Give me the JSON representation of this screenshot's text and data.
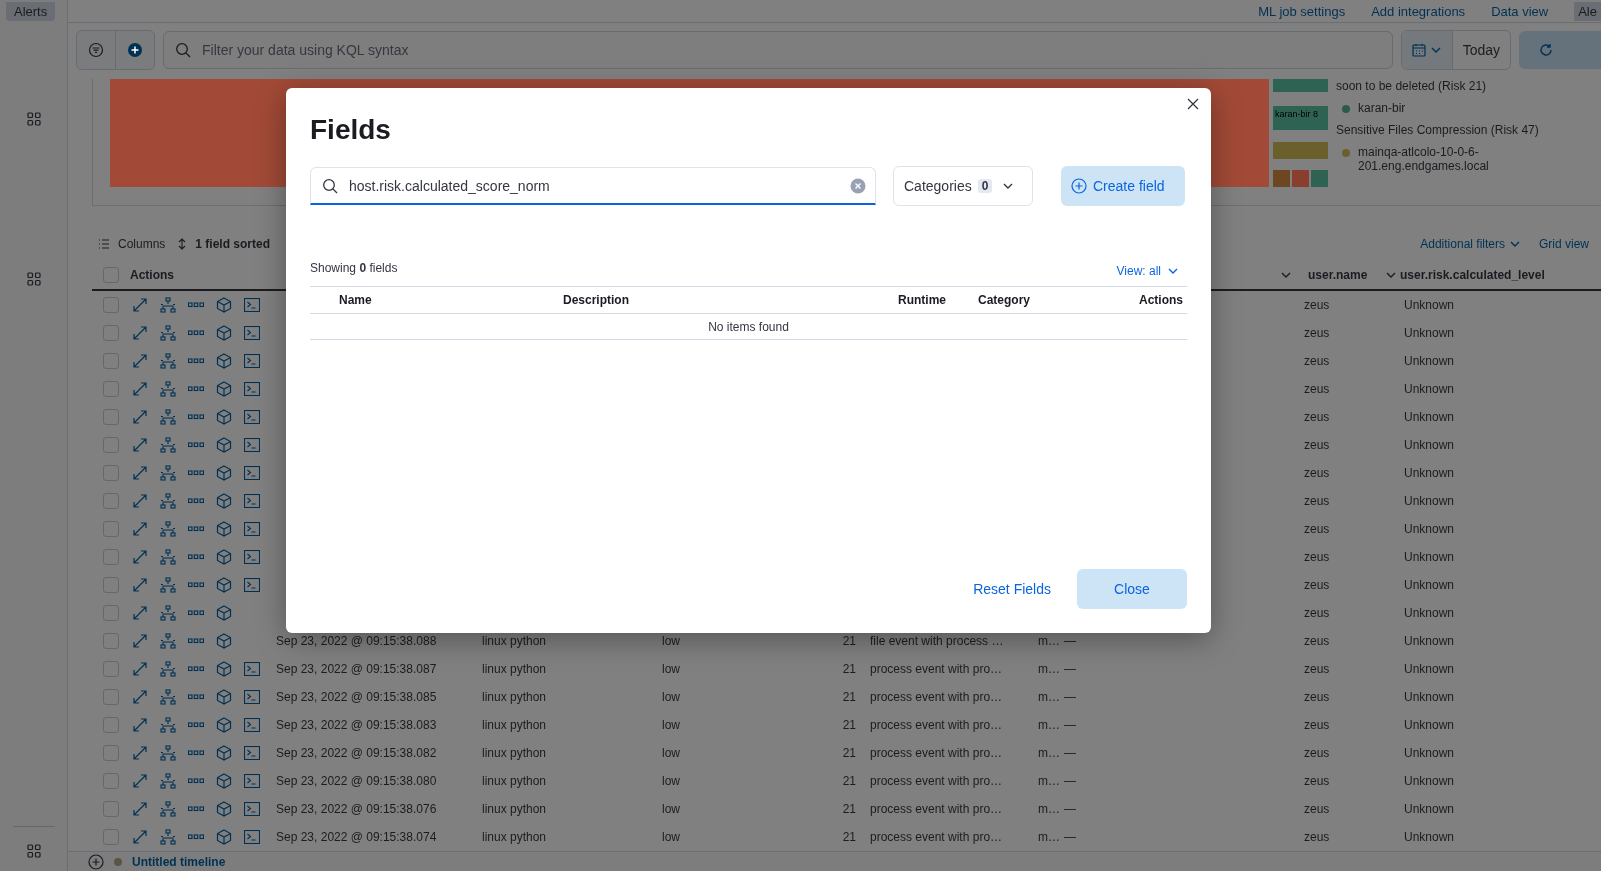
{
  "top_bar": {
    "tab": "Alerts",
    "links": [
      {
        "label": "ML job settings"
      },
      {
        "label": "Add integrations"
      },
      {
        "label": "Data view"
      }
    ],
    "corner_tab": "Ale"
  },
  "query_bar": {
    "placeholder": "Filter your data using KQL syntax",
    "date": "Today"
  },
  "treemap": {
    "block_label": "karan-bir 8",
    "legend": [
      {
        "kind": "group",
        "label": "soon to be deleted (Risk 21)"
      },
      {
        "kind": "host",
        "label": "karan-bir",
        "color": "#2a5a4c"
      },
      {
        "kind": "group",
        "label": "Sensitive Files Compression (Risk 47)"
      },
      {
        "kind": "host",
        "label": "mainqa-atlcolo-10-0-6-201.eng.endgames.local",
        "color": "#6b602c"
      }
    ]
  },
  "toolbar": {
    "columns": "Columns",
    "sorted": "1 field sorted",
    "additional_filters": "Additional filters",
    "grid_view": "Grid view"
  },
  "table": {
    "header_checked": false,
    "columns": [
      {
        "label": "Actions"
      },
      {
        "label": "user.name"
      },
      {
        "label": "user.risk.calculated_level"
      }
    ],
    "rows": [
      {
        "checked": false,
        "session_icon": true,
        "user": "zeus",
        "level": "Unknown"
      },
      {
        "checked": false,
        "session_icon": true,
        "user": "zeus",
        "level": "Unknown"
      },
      {
        "checked": false,
        "session_icon": true,
        "user": "zeus",
        "level": "Unknown"
      },
      {
        "checked": false,
        "session_icon": true,
        "user": "zeus",
        "level": "Unknown"
      },
      {
        "checked": false,
        "session_icon": true,
        "user": "zeus",
        "level": "Unknown"
      },
      {
        "checked": false,
        "session_icon": true,
        "user": "zeus",
        "level": "Unknown"
      },
      {
        "checked": false,
        "session_icon": true,
        "user": "zeus",
        "level": "Unknown"
      },
      {
        "checked": false,
        "session_icon": true,
        "user": "zeus",
        "level": "Unknown"
      },
      {
        "checked": false,
        "session_icon": true,
        "user": "zeus",
        "level": "Unknown"
      },
      {
        "checked": false,
        "session_icon": true,
        "user": "zeus",
        "level": "Unknown"
      },
      {
        "checked": false,
        "session_icon": true,
        "user": "zeus",
        "level": "Unknown"
      },
      {
        "checked": false,
        "session_icon": false,
        "user": "zeus",
        "level": "Unknown"
      },
      {
        "checked": false,
        "session_icon": false,
        "timestamp": "Sep 23, 2022 @ 09:15:38.088",
        "rule": "linux python",
        "severity": "low",
        "score": "21",
        "reason": "file event with process …",
        "col_8": "m…",
        "col_9": "—",
        "user": "zeus",
        "level": "Unknown"
      },
      {
        "checked": false,
        "session_icon": true,
        "timestamp": "Sep 23, 2022 @ 09:15:38.087",
        "rule": "linux python",
        "severity": "low",
        "score": "21",
        "reason": "process event with pro…",
        "col_8": "m…",
        "col_9": "—",
        "user": "zeus",
        "level": "Unknown"
      },
      {
        "checked": false,
        "session_icon": true,
        "timestamp": "Sep 23, 2022 @ 09:15:38.085",
        "rule": "linux python",
        "severity": "low",
        "score": "21",
        "reason": "process event with pro…",
        "col_8": "m…",
        "col_9": "—",
        "user": "zeus",
        "level": "Unknown"
      },
      {
        "checked": false,
        "session_icon": true,
        "timestamp": "Sep 23, 2022 @ 09:15:38.083",
        "rule": "linux python",
        "severity": "low",
        "score": "21",
        "reason": "process event with pro…",
        "col_8": "m…",
        "col_9": "—",
        "user": "zeus",
        "level": "Unknown"
      },
      {
        "checked": false,
        "session_icon": true,
        "timestamp": "Sep 23, 2022 @ 09:15:38.082",
        "rule": "linux python",
        "severity": "low",
        "score": "21",
        "reason": "process event with pro…",
        "col_8": "m…",
        "col_9": "—",
        "user": "zeus",
        "level": "Unknown"
      },
      {
        "checked": false,
        "session_icon": true,
        "timestamp": "Sep 23, 2022 @ 09:15:38.080",
        "rule": "linux python",
        "severity": "low",
        "score": "21",
        "reason": "process event with pro…",
        "col_8": "m…",
        "col_9": "—",
        "user": "zeus",
        "level": "Unknown"
      },
      {
        "checked": false,
        "session_icon": true,
        "timestamp": "Sep 23, 2022 @ 09:15:38.076",
        "rule": "linux python",
        "severity": "low",
        "score": "21",
        "reason": "process event with pro…",
        "col_8": "m…",
        "col_9": "—",
        "user": "zeus",
        "level": "Unknown"
      },
      {
        "checked": false,
        "session_icon": true,
        "timestamp": "Sep 23, 2022 @ 09:15:38.074",
        "rule": "linux python",
        "severity": "low",
        "score": "21",
        "reason": "process event with pro…",
        "col_8": "m…",
        "col_9": "—",
        "user": "zeus",
        "level": "Unknown"
      }
    ]
  },
  "timeline_bar": {
    "title": "Untitled timeline"
  },
  "modal": {
    "title": "Fields",
    "search_value": "host.risk.calculated_score_norm",
    "categories": {
      "label": "Categories",
      "count": "0"
    },
    "create_button": "Create field",
    "showing": "Showing **0** fields",
    "view_link": "View: all",
    "columns": [
      {
        "label": "Name"
      },
      {
        "label": "Description"
      },
      {
        "label": "Runtime"
      },
      {
        "label": "Category"
      },
      {
        "label": "Actions"
      }
    ],
    "empty_message": "No items found",
    "reset_button": "Reset Fields",
    "close_button": "Close"
  }
}
